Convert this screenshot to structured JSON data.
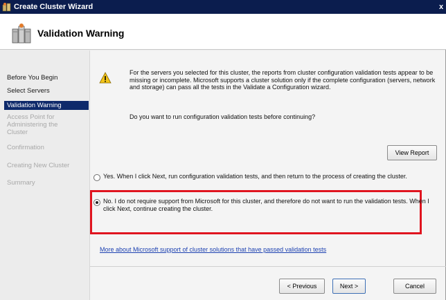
{
  "window": {
    "title": "Create Cluster Wizard",
    "close_glyph": "x"
  },
  "header": {
    "title": "Validation Warning"
  },
  "steps": [
    {
      "label": "Before You Begin",
      "state": "normal"
    },
    {
      "label": "Select Servers",
      "state": "normal"
    },
    {
      "label": "Validation Warning",
      "state": "active"
    },
    {
      "label": "Access Point for Administering the Cluster",
      "state": "disabled"
    },
    {
      "label": "Confirmation",
      "state": "disabled"
    },
    {
      "label": "Creating New Cluster",
      "state": "disabled"
    },
    {
      "label": "Summary",
      "state": "disabled"
    }
  ],
  "main": {
    "message": "For the servers you selected for this cluster, the reports from cluster configuration validation tests appear to be missing or incomplete.  Microsoft supports a cluster solution only if the complete configuration (servers, network and storage) can pass all the tests in the Validate a Configuration wizard.",
    "question": "Do you want to run configuration validation tests before continuing?",
    "view_report_label": "View Report",
    "option_yes": "Yes.  When I click Next, run configuration validation tests, and then return to the process of creating the cluster.",
    "option_no": "No.  I do not require support from Microsoft for this cluster, and therefore do not want to run the validation tests.  When I click Next, continue creating the cluster.",
    "selected_option": "no",
    "link": "More about Microsoft support of cluster solutions that have passed validation tests"
  },
  "footer": {
    "previous_label": "< Previous",
    "next_label": "Next >",
    "cancel_label": "Cancel"
  },
  "colors": {
    "titlebar": "#0b1d4e",
    "active_step": "#0e2a6b",
    "highlight": "#e0141f",
    "link": "#1a3fb0"
  }
}
